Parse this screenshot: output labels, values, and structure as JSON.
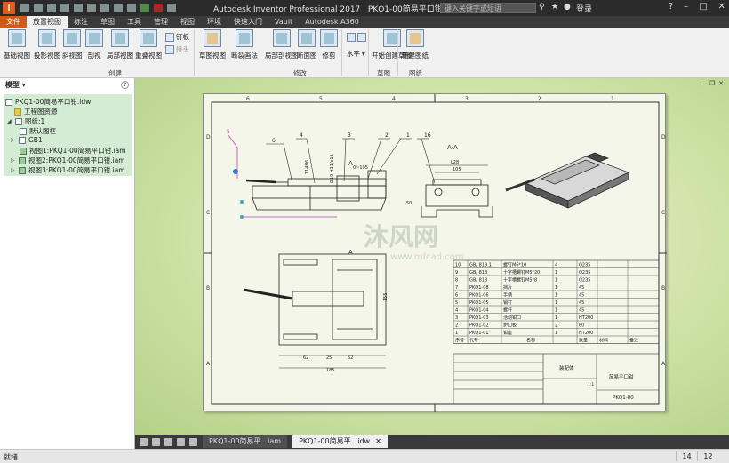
{
  "titlebar": {
    "app_title": "Autodesk Inventor Professional 2017",
    "doc_title": "PKQ1-00简易平口钳.idw",
    "search_placeholder": "键入关键字或短语",
    "user": "登录"
  },
  "ribbon_tabs": [
    "文件",
    "放置视图",
    "标注",
    "草图",
    "工具",
    "管理",
    "视图",
    "环境",
    "快速入门",
    "Vault",
    "Autodesk A360"
  ],
  "ribbon": {
    "create": {
      "buttons": [
        "基础视图",
        "投影视图",
        "斜视图",
        "剖视",
        "局部视图",
        "重叠视图"
      ],
      "small": [
        "钉板",
        "接头"
      ],
      "label": "创建"
    },
    "modify": {
      "buttons": [
        "草图视图",
        "断裂画法",
        "局部剖视图",
        "断面图",
        "修剪"
      ],
      "label": "修改"
    },
    "align": {
      "label": "水平"
    },
    "sketch": {
      "button": "开始创建草图",
      "label": "草图"
    },
    "sheets": {
      "button": "新建图纸",
      "label": "图纸"
    }
  },
  "browser": {
    "title": "模型",
    "items": [
      "PKQ1-00简易平口钳.idw",
      "工程图资源",
      "图纸:1",
      "默认图框",
      "GB1",
      "视图1:PKQ1-00简易平口钳.iam",
      "视图2:PKQ1-00简易平口钳.iam",
      "视图3:PKQ1-00简易平口钳.iam"
    ]
  },
  "drawing": {
    "section_label": "A-A",
    "border_letters": [
      "D",
      "C",
      "B",
      "A"
    ],
    "border_numbers": [
      "1",
      "2",
      "3",
      "4",
      "5",
      "6"
    ],
    "balloons": [
      "5",
      "6",
      "4",
      "3",
      "2",
      "1",
      "16"
    ],
    "dimensions": {
      "d1": "L28",
      "d2": "105",
      "d3": "50",
      "d4": "155",
      "d5": "62",
      "d6": "25",
      "d7": "62",
      "d8": "185",
      "tol1": "T14H6",
      "tol2": "Ø10 H11/c11",
      "tol3": "0~105"
    },
    "bom_header": [
      "序号",
      "代号",
      "名称",
      "数量",
      "材料",
      "备注"
    ],
    "bom_rows": [
      [
        "10",
        "GB/ 819.1",
        "螺钉M6*10",
        "4",
        "Q235"
      ],
      [
        "9",
        "GB/ 818",
        "十字槽螺钉M5*20",
        "1",
        "Q235"
      ],
      [
        "8",
        "GB/ 818",
        "十字槽螺钉M5*8",
        "1",
        "Q235"
      ],
      [
        "7",
        "PKQ1-08",
        "挡片",
        "1",
        "45"
      ],
      [
        "6",
        "PKQ1-06",
        "手柄",
        "1",
        "45"
      ],
      [
        "5",
        "PKQ1-05",
        "销钉",
        "1",
        "45"
      ],
      [
        "4",
        "PKQ1-04",
        "螺杆",
        "1",
        "45"
      ],
      [
        "3",
        "PKQ1-03",
        "活动钳口",
        "1",
        "HT200"
      ],
      [
        "2",
        "PKQ1-02",
        "护口板",
        "2",
        "60"
      ],
      [
        "1",
        "PKQ1-01",
        "钳座",
        "1",
        "HT200"
      ]
    ],
    "title_block": {
      "assembly": "装配体",
      "name": "简易平口钳",
      "code": "PKQ1-00",
      "scale": "1:1"
    },
    "watermark_main": "沐风网",
    "watermark_url": "www.mfcad.com"
  },
  "doc_tabs": [
    "PKQ1-00简易平...iam",
    "PKQ1-00简易平...idw"
  ],
  "status": {
    "text": "就绪",
    "num1": "14",
    "num2": "12"
  }
}
